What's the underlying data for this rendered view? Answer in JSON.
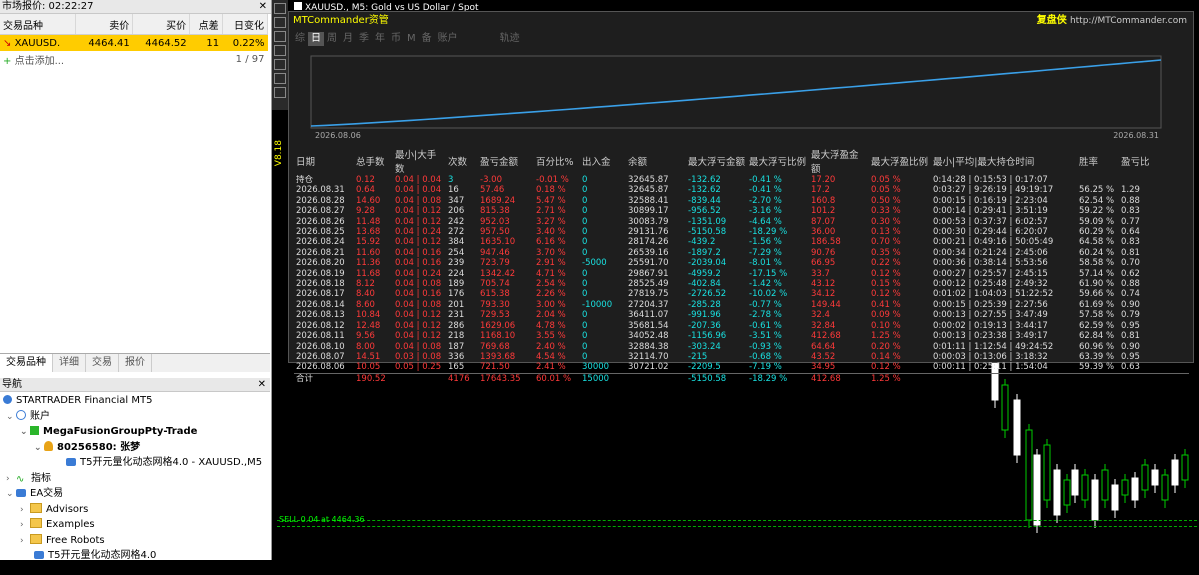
{
  "market": {
    "title": "市场报价: 02:22:27",
    "columns": [
      "交易品种",
      "卖价",
      "买价",
      "点差",
      "日变化"
    ],
    "rows": [
      {
        "symbol": "XAUUSD.",
        "bid": "4464.41",
        "ask": "4464.52",
        "spread": "11",
        "change": "0.22%"
      }
    ],
    "add_label": "点击添加...",
    "count": "1 / 97",
    "tabs": [
      "交易品种",
      "详细",
      "交易",
      "报价"
    ]
  },
  "nav": {
    "title": "导航",
    "items": [
      {
        "label": "STARTRADER Financial MT5",
        "indent": 0,
        "icon": "broker-icon"
      },
      {
        "label": "账户",
        "indent": 1,
        "icon": "accounts-icon"
      },
      {
        "label": "MegaFusionGroupPty-Trade",
        "indent": 2,
        "icon": "server-icon"
      },
      {
        "label": "80256580: 张梦",
        "indent": 3,
        "icon": "user-icon"
      },
      {
        "label": "T5开元量化动态网格4.0 - XAUUSD.,M5",
        "indent": 4,
        "icon": "ea-icon"
      },
      {
        "label": "指标",
        "indent": 1,
        "icon": "indicators-icon"
      },
      {
        "label": "EA交易",
        "indent": 1,
        "icon": "experts-icon"
      },
      {
        "label": "Advisors",
        "indent": 2,
        "icon": "folder-icon"
      },
      {
        "label": "Examples",
        "indent": 2,
        "icon": "folder-icon"
      },
      {
        "label": "Free Robots",
        "indent": 2,
        "icon": "folder-icon"
      },
      {
        "label": "T5开元量化动态网格4.0",
        "indent": 2,
        "icon": "ea-icon"
      }
    ]
  },
  "chart": {
    "title": "XAUUSD., M5:  Gold vs US Dollar / Spot",
    "side_label": "V8.18",
    "hline_label": "SELL 0.04 at 4464.36",
    "panel_title": "MTCommander资管",
    "panel_right": "复盘侠",
    "panel_url": "http://MTCommander.com",
    "tabs": [
      "综",
      "日",
      "周",
      "月",
      "季",
      "年",
      "币",
      "M",
      "备",
      "账户",
      "轨迹"
    ],
    "active_tab": "日",
    "eq_start": "2026.08.06",
    "eq_end": "2026.08.31"
  },
  "chart_data": {
    "type": "line",
    "title": "",
    "x": [
      "2026.08.06",
      "2026.08.07",
      "2026.08.10",
      "2026.08.11",
      "2026.08.12",
      "2026.08.13",
      "2026.08.14",
      "2026.08.17",
      "2026.08.18",
      "2026.08.19",
      "2026.08.20",
      "2026.08.21",
      "2026.08.24",
      "2026.08.25",
      "2026.08.26",
      "2026.08.27",
      "2026.08.28",
      "2026.08.31"
    ],
    "series": [
      {
        "values": [
          30721.02,
          32114.7,
          32884.38,
          34052.48,
          35681.54,
          36411.07,
          27204.37,
          27819.75,
          28525.49,
          29867.91,
          25591.7,
          26539.16,
          28174.26,
          29131.76,
          30083.79,
          30899.17,
          32588.41,
          32645.87
        ]
      }
    ],
    "table": {
      "headers": [
        "日期",
        "总手数",
        "最小|大手数",
        "次数",
        "盈亏金额",
        "百分比%",
        "出入金",
        "余额",
        "最大浮亏金额",
        "最大浮亏比例",
        "最大浮盈金额",
        "最大浮盈比例",
        "最小|平均|最大持仓时间",
        "胜率",
        "盈亏比"
      ],
      "holding": [
        "持仓",
        "0.12",
        "0.04 | 0.04",
        "3",
        "-3.00",
        "-0.01 %",
        "0",
        "32645.87",
        "-132.62",
        "-0.41 %",
        "17.20",
        "0.05 %",
        "0:14:28 | 0:15:53 | 0:17:07",
        "",
        ""
      ],
      "rows": [
        [
          "2026.08.31",
          "0.64",
          "0.04 | 0.04",
          "16",
          "57.46",
          "0.18 %",
          "0",
          "32645.87",
          "-132.62",
          "-0.41 %",
          "17.2",
          "0.05 %",
          "0:03:27 | 9:26:19 | 49:19:17",
          "56.25 %",
          "1.29"
        ],
        [
          "2026.08.28",
          "14.60",
          "0.04 | 0.08",
          "347",
          "1689.24",
          "5.47 %",
          "0",
          "32588.41",
          "-839.44",
          "-2.70 %",
          "160.8",
          "0.50 %",
          "0:00:15 | 0:16:19 | 2:23:04",
          "62.54 %",
          "0.88"
        ],
        [
          "2026.08.27",
          "9.28",
          "0.04 | 0.12",
          "206",
          "815.38",
          "2.71 %",
          "0",
          "30899.17",
          "-956.52",
          "-3.16 %",
          "101.2",
          "0.33 %",
          "0:00:14 | 0:29:41 | 3:51:19",
          "59.22 %",
          "0.83"
        ],
        [
          "2026.08.26",
          "11.48",
          "0.04 | 0.12",
          "242",
          "952.03",
          "3.27 %",
          "0",
          "30083.79",
          "-1351.09",
          "-4.64 %",
          "87.07",
          "0.30 %",
          "0:00:53 | 0:37:37 | 6:02:57",
          "59.09 %",
          "0.77"
        ],
        [
          "2026.08.25",
          "13.68",
          "0.04 | 0.24",
          "272",
          "957.50",
          "3.40 %",
          "0",
          "29131.76",
          "-5150.58",
          "-18.29 %",
          "36.00",
          "0.13 %",
          "0:00:30 | 0:29:44 | 6:20:07",
          "60.29 %",
          "0.64"
        ],
        [
          "2026.08.24",
          "15.92",
          "0.04 | 0.12",
          "384",
          "1635.10",
          "6.16 %",
          "0",
          "28174.26",
          "-439.2",
          "-1.56 %",
          "186.58",
          "0.70 %",
          "0:00:21 | 0:49:16 | 50:05:49",
          "64.58 %",
          "0.83"
        ],
        [
          "2026.08.21",
          "11.60",
          "0.04 | 0.16",
          "254",
          "947.46",
          "3.70 %",
          "0",
          "26539.16",
          "-1897.2",
          "-7.29 %",
          "90.76",
          "0.35 %",
          "0:00:34 | 0:21:24 | 2:45:06",
          "60.24 %",
          "0.81"
        ],
        [
          "2026.08.20",
          "11.36",
          "0.04 | 0.16",
          "239",
          "723.79",
          "2.91 %",
          "-5000",
          "25591.70",
          "-2039.04",
          "-8.01 %",
          "66.95",
          "0.22 %",
          "0:00:36 | 0:38:14 | 5:53:56",
          "58.58 %",
          "0.70"
        ],
        [
          "2026.08.19",
          "11.68",
          "0.04 | 0.24",
          "224",
          "1342.42",
          "4.71 %",
          "0",
          "29867.91",
          "-4959.2",
          "-17.15 %",
          "33.7",
          "0.12 %",
          "0:00:27 | 0:25:57 | 2:45:15",
          "57.14 %",
          "0.62"
        ],
        [
          "2026.08.18",
          "8.12",
          "0.04 | 0.08",
          "189",
          "705.74",
          "2.54 %",
          "0",
          "28525.49",
          "-402.84",
          "-1.42 %",
          "43.12",
          "0.15 %",
          "0:00:12 | 0:25:48 | 2:49:32",
          "61.90 %",
          "0.88"
        ],
        [
          "2026.08.17",
          "8.40",
          "0.04 | 0.16",
          "176",
          "615.38",
          "2.26 %",
          "0",
          "27819.75",
          "-2726.52",
          "-10.02 %",
          "34.12",
          "0.12 %",
          "0:01:02 | 1:04:03 | 51:22:52",
          "59.66 %",
          "0.74"
        ],
        [
          "2026.08.14",
          "8.60",
          "0.04 | 0.08",
          "201",
          "793.30",
          "3.00 %",
          "-10000",
          "27204.37",
          "-285.28",
          "-0.77 %",
          "149.44",
          "0.41 %",
          "0:00:15 | 0:25:39 | 2:27:56",
          "61.69 %",
          "0.90"
        ],
        [
          "2026.08.13",
          "10.84",
          "0.04 | 0.12",
          "231",
          "729.53",
          "2.04 %",
          "0",
          "36411.07",
          "-991.96",
          "-2.78 %",
          "32.4",
          "0.09 %",
          "0:00:13 | 0:27:55 | 3:47:49",
          "57.58 %",
          "0.79"
        ],
        [
          "2026.08.12",
          "12.48",
          "0.04 | 0.12",
          "286",
          "1629.06",
          "4.78 %",
          "0",
          "35681.54",
          "-207.36",
          "-0.61 %",
          "32.84",
          "0.10 %",
          "0:00:02 | 0:19:13 | 3:44:17",
          "62.59 %",
          "0.95"
        ],
        [
          "2026.08.11",
          "9.56",
          "0.04 | 0.12",
          "218",
          "1168.10",
          "3.55 %",
          "0",
          "34052.48",
          "-1156.96",
          "-3.51 %",
          "412.68",
          "1.25 %",
          "0:00:13 | 0:23:38 | 3:49:17",
          "62.84 %",
          "0.81"
        ],
        [
          "2026.08.10",
          "8.00",
          "0.04 | 0.08",
          "187",
          "769.68",
          "2.40 %",
          "0",
          "32884.38",
          "-303.24",
          "-0.93 %",
          "64.64",
          "0.20 %",
          "0:01:11 | 1:12:54 | 49:24:52",
          "60.96 %",
          "0.90"
        ],
        [
          "2026.08.07",
          "14.51",
          "0.03 | 0.08",
          "336",
          "1393.68",
          "4.54 %",
          "0",
          "32114.70",
          "-215",
          "-0.68 %",
          "43.52",
          "0.14 %",
          "0:00:03 | 0:13:06 | 3:18:32",
          "63.39 %",
          "0.95"
        ],
        [
          "2026.08.06",
          "10.05",
          "0.05 | 0.25",
          "165",
          "721.50",
          "2.41 %",
          "30000",
          "30721.02",
          "-2209.5",
          "-7.19 %",
          "34.95",
          "0.12 %",
          "0:00:11 | 0:25:11 | 1:54:04",
          "59.39 %",
          "0.63"
        ]
      ],
      "total": [
        "合计",
        "190.52",
        "",
        "4176",
        "17643.35",
        "60.01 %",
        "15000",
        "",
        "-5150.58",
        "-18.29 %",
        "412.68",
        "1.25 %",
        "",
        "",
        ""
      ]
    }
  }
}
